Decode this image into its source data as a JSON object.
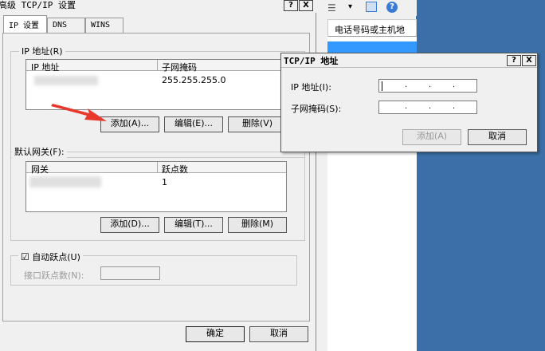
{
  "main_dialog": {
    "title": "高级 TCP/IP 设置",
    "tabs": [
      {
        "label": "IP 设置"
      },
      {
        "label": "DNS"
      },
      {
        "label": "WINS"
      }
    ],
    "ip_group": {
      "legend": "IP 地址(R)",
      "columns": [
        "IP 地址",
        "子网掩码"
      ],
      "rows": [
        {
          "ip": "",
          "mask": "255.255.255.0"
        }
      ],
      "buttons": {
        "add": "添加(A)...",
        "edit": "编辑(E)...",
        "delete": "删除(V)"
      }
    },
    "gateway_group": {
      "legend": "默认网关(F):",
      "columns": [
        "网关",
        "跃点数"
      ],
      "rows": [
        {
          "gateway": "",
          "metric": "1"
        }
      ],
      "buttons": {
        "add": "添加(D)...",
        "edit": "编辑(T)...",
        "delete": "删除(M)"
      }
    },
    "auto_metric": {
      "label": "自动跃点(U)",
      "checked": true,
      "metric_label": "接口跃点数(N):",
      "metric_value": ""
    },
    "footer": {
      "ok": "确定",
      "cancel": "取消"
    }
  },
  "background_window": {
    "column_header": "电话号码或主机地"
  },
  "ip_dialog": {
    "title": "TCP/IP 地址",
    "ip_label": "IP 地址(I):",
    "mask_label": "子网掩码(S):",
    "add_button": "添加(A)",
    "cancel_button": "取消"
  },
  "icons": {
    "help": "?",
    "close": "X",
    "checkbox": "☑"
  },
  "colors": {
    "desktop": "#3c6fa8",
    "arrow": "#e8382c"
  }
}
